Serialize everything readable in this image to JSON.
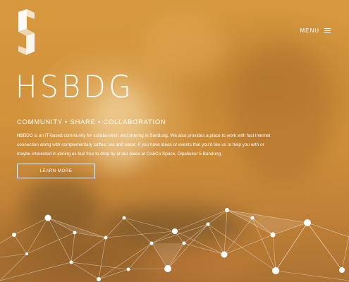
{
  "header": {
    "menu_label": "MENU",
    "logo_icon": "hsbdg-s-logo-icon",
    "menu_icon": "hamburger-menu-icon"
  },
  "hero": {
    "title_bold": "HS",
    "title_light": "BDG",
    "tagline": "COMMUNITY • SHARE • COLLABORATION",
    "description_brand": "HS",
    "description_rest": "BDG is an IT-based community for collaboration and sharing in Bandung. We also provides a place to work with fast internet connection along with complementary coffee, tea and water. If you have ideas or events that you'd like us to help you with or maybe interested in joining us feel free to drop by at our place at Co&Co Space, Dipatiukur 5 Bandung.",
    "cta_label": "LEARN MORE"
  },
  "colors": {
    "overlay": "#d6963c",
    "text": "#ffffff"
  }
}
